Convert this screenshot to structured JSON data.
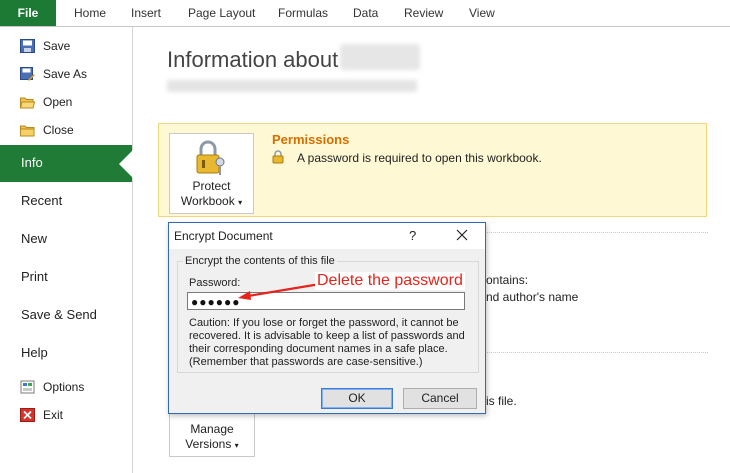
{
  "ribbon": {
    "file_tab": "File",
    "tabs": [
      "Home",
      "Insert",
      "Page Layout",
      "Formulas",
      "Data",
      "Review",
      "View"
    ]
  },
  "backstage": {
    "commands": [
      {
        "label": "Save",
        "icon": "save-icon"
      },
      {
        "label": "Save As",
        "icon": "save-as-icon"
      },
      {
        "label": "Open",
        "icon": "open-folder-icon"
      },
      {
        "label": "Close",
        "icon": "close-folder-icon"
      }
    ],
    "active_item": "Info",
    "nav": [
      "Recent",
      "New",
      "Print",
      "Save & Send",
      "Help"
    ],
    "bottom_commands": [
      {
        "label": "Options",
        "icon": "options-icon"
      },
      {
        "label": "Exit",
        "icon": "exit-icon"
      }
    ]
  },
  "info": {
    "title": "Information about",
    "protect_button": {
      "line1": "Protect",
      "line2": "Workbook",
      "icon": "lock-keys-icon"
    },
    "permissions_title": "Permissions",
    "permissions_desc": "A password is required to open this workbook.",
    "partial_contains": "ontains:",
    "partial_author": "nd author's name",
    "partial_file": "is file.",
    "manage_button": {
      "line1": "Manage",
      "line2": "Versions"
    }
  },
  "dialog": {
    "title": "Encrypt Document",
    "help": "?",
    "group_label": "Encrypt the contents of this file",
    "password_label": "Password:",
    "password_value": "●●●●●●",
    "caution": "Caution: If you lose or forget the password, it cannot be recovered. It is advisable to keep a list of passwords and their corresponding document names in a safe place. (Remember that passwords are case-sensitive.)",
    "ok": "OK",
    "cancel": "Cancel"
  },
  "annotation": {
    "text": "Delete the password",
    "color": "#e8231b"
  },
  "colors": {
    "file_tab": "#1d7a35",
    "info_active": "#1f7b36",
    "permissions_title": "#d86d00",
    "permissions_band": "#fff8d4"
  }
}
